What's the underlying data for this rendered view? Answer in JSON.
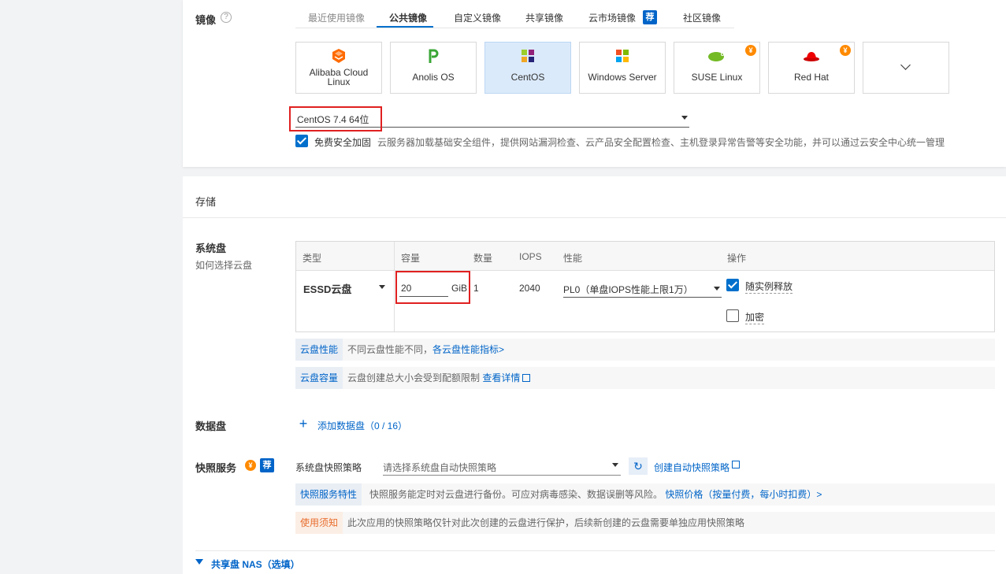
{
  "image_section": {
    "label": "镜像",
    "tabs": [
      {
        "label": "最近使用镜像",
        "state": "muted"
      },
      {
        "label": "公共镜像",
        "state": "active"
      },
      {
        "label": "自定义镜像",
        "state": "normal"
      },
      {
        "label": "共享镜像",
        "state": "normal"
      },
      {
        "label": "云市场镜像",
        "state": "normal"
      },
      {
        "label": "社区镜像",
        "state": "normal"
      }
    ],
    "market_badge": "荐",
    "os_cards": [
      {
        "label_line1": "Alibaba Cloud",
        "label_line2": "Linux",
        "icon": "alibaba-cloud-linux-icon"
      },
      {
        "label": "Anolis OS",
        "icon": "anolis-os-icon"
      },
      {
        "label": "CentOS",
        "icon": "centos-icon",
        "selected": true
      },
      {
        "label": "Windows Server",
        "icon": "windows-icon"
      },
      {
        "label": "SUSE Linux",
        "icon": "suse-icon",
        "paid": "¥"
      },
      {
        "label": "Red Hat",
        "icon": "redhat-icon",
        "paid": "¥"
      }
    ],
    "version_value": "CentOS 7.4 64位",
    "security_checkbox_label": "免费安全加固",
    "security_hint": "云服务器加载基础安全组件，提供网站漏洞检查、云产品安全配置检查、主机登录异常告警等安全功能，并可以通过云安全中心统一管理"
  },
  "storage_section": {
    "title": "存储",
    "system_disk": {
      "label": "系统盘",
      "help_link": "如何选择云盘",
      "columns": [
        "类型",
        "容量",
        "数量",
        "IOPS",
        "性能",
        "操作"
      ],
      "type_value": "ESSD云盘",
      "capacity_value": "20",
      "capacity_unit": "GiB",
      "count": "1",
      "iops": "2040",
      "performance_value": "PL0（单盘IOPS性能上限1万）",
      "release_with_instance_label": "随实例释放",
      "encrypt_label": "加密"
    },
    "disk_perf_tag": "云盘性能",
    "disk_perf_text": "不同云盘性能不同，",
    "disk_perf_link": "各云盘性能指标>",
    "disk_capacity_tag": "云盘容量",
    "disk_capacity_text": "云盘创建总大小会受到配额限制",
    "disk_capacity_link": "查看详情",
    "data_disk": {
      "label": "数据盘",
      "add_label": "添加数据盘（0 / 16）"
    },
    "snapshot": {
      "label": "快照服务",
      "coin": "¥",
      "badge": "荐",
      "policy_label": "系统盘快照策略",
      "policy_placeholder": "请选择系统盘自动快照策略",
      "create_link": "创建自动快照策略",
      "feature_tag": "快照服务特性",
      "feature_text": "快照服务能定时对云盘进行备份。可应对病毒感染、数据误删等风险。",
      "feature_link": "快照价格（按量付费，每小时扣费）>",
      "notice_tag": "使用须知",
      "notice_text": "此次应用的快照策略仅针对此次创建的云盘进行保护，后续新创建的云盘需要单独应用快照策略"
    },
    "nas_label": "共享盘 NAS（选填）"
  },
  "colors": {
    "accent": "#0064c8",
    "highlight_box": "#e02020",
    "warn": "#e86d2d",
    "paid_coin": "#ff8a00"
  }
}
